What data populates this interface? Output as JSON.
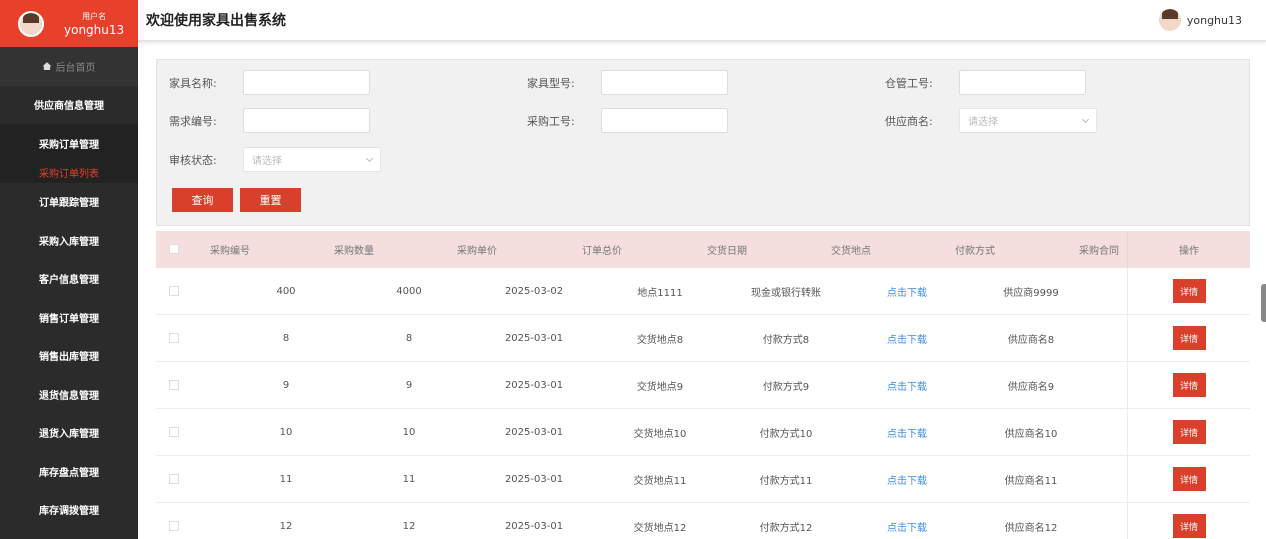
{
  "user": {
    "role_label": "用户名",
    "name": "yonghu13"
  },
  "sidebar": {
    "home": "后台首页",
    "items": [
      "供应商信息管理",
      "采购订单管理",
      "采购订单列表",
      "订单跟踪管理",
      "采购入库管理",
      "客户信息管理",
      "销售订单管理",
      "销售出库管理",
      "退货信息管理",
      "退货入库管理",
      "库存盘点管理",
      "库存调拨管理"
    ]
  },
  "header": {
    "title": "欢迎使用家具出售系统",
    "username": "yonghu13"
  },
  "search": {
    "furniture_name_label": "家具名称:",
    "furniture_model_label": "家具型号:",
    "warehouse_no_label": "仓管工号:",
    "demand_no_label": "需求编号:",
    "purchase_no_label": "采购工号:",
    "supplier_label": "供应商名:",
    "supplier_placeholder": "请选择",
    "audit_label": "审核状态:",
    "audit_placeholder": "请选择",
    "query_button": "查询",
    "reset_button": "重置"
  },
  "table": {
    "columns": [
      "采购编号",
      "采购数量",
      "采购单价",
      "订单总价",
      "交货日期",
      "交货地点",
      "付款方式",
      "采购合同",
      "操作"
    ],
    "rows": [
      [
        "400",
        "4000",
        "2025-03-02",
        "地点1111",
        "现金或银行转账",
        "点击下载",
        "供应商9999"
      ],
      [
        "8",
        "8",
        "2025-03-01",
        "交货地点8",
        "付款方式8",
        "点击下载",
        "供应商名8"
      ],
      [
        "9",
        "9",
        "2025-03-01",
        "交货地点9",
        "付款方式9",
        "点击下载",
        "供应商名9"
      ],
      [
        "10",
        "10",
        "2025-03-01",
        "交货地点10",
        "付款方式10",
        "点击下载",
        "供应商名10"
      ],
      [
        "11",
        "11",
        "2025-03-01",
        "交货地点11",
        "付款方式11",
        "点击下载",
        "供应商名11"
      ],
      [
        "12",
        "12",
        "2025-03-01",
        "交货地点12",
        "付款方式12",
        "点击下载",
        "供应商名12"
      ]
    ],
    "detail_label": "详情"
  },
  "colors": {
    "accent": "#d8402c",
    "sidebar_bg": "#2b2b2b",
    "header_row_bg": "#f4dede",
    "link": "#3a8ee6"
  }
}
